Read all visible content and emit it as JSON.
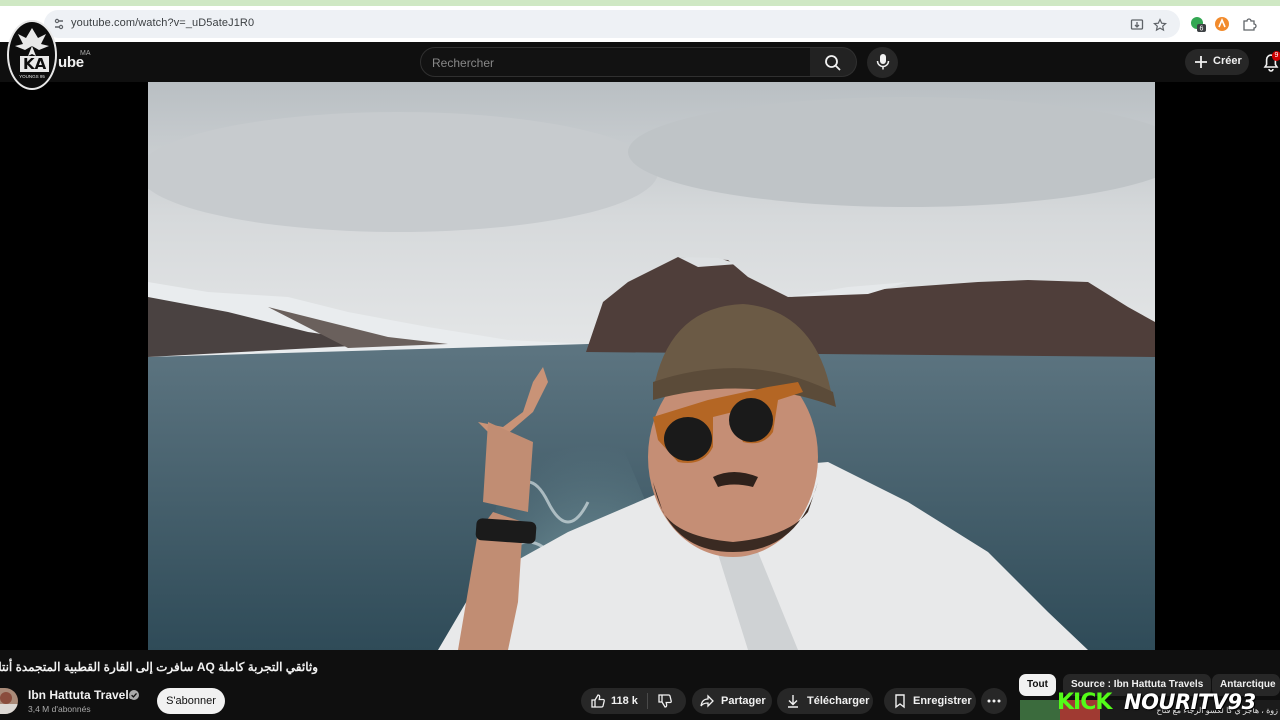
{
  "browser": {
    "url": "youtube.com/watch?v=_uD5ateJ1R0",
    "extension_badge": "6"
  },
  "masthead": {
    "brand_text": "ube",
    "country_code": "MA",
    "search_placeholder": "Rechercher",
    "create_label": "Créer",
    "notification_count": "9",
    "channel_logo_text": "KA",
    "channel_logo_subtext": "YOUNGS 95"
  },
  "video": {
    "title": "وثائقي التجربة كاملة AQ سافرت إلى القارة القطبية المتجمدة أنتاركتيكا",
    "scene": "player-frame-with-sea-cliffs-and-presenter"
  },
  "owner": {
    "name": "Ibn Hattuta Travels",
    "subscribers": "3,4 M d'abonnés",
    "subscribe_label": "S'abonner"
  },
  "actions": {
    "like_count": "118 k",
    "share_label": "Partager",
    "download_label": "Télécharger",
    "save_label": "Enregistrer"
  },
  "chips": [
    "Tout",
    "Source : Ibn Hattuta Travels",
    "Antarctique"
  ],
  "overlay": {
    "kick_logo": "KICK",
    "kick_handle": "NOURITV93",
    "rec_snippet": "زوة ، هاجر ي كا لكسو الرجاء مع فتاح"
  },
  "colors": {
    "background": "#0f0f0f",
    "chip_active": "#f1f1f1",
    "kick_green": "#53fc18"
  }
}
